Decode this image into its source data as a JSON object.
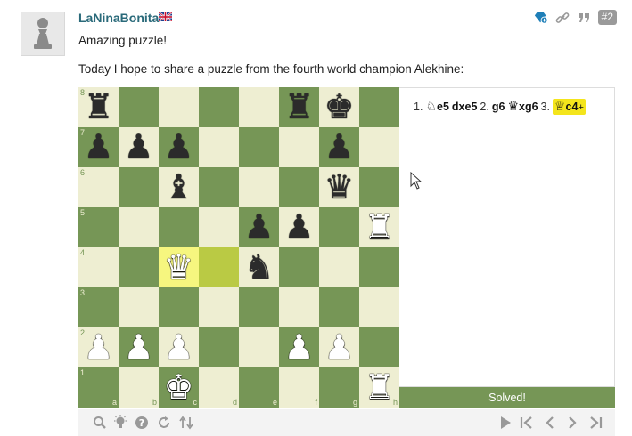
{
  "post": {
    "username": "LaNinaBonita",
    "flag_icon": "uk-flag-icon",
    "post_number": "#2",
    "greeting": "Amazing puzzle!",
    "intro": "Today I hope to share a puzzle from the fourth world champion Alekhine:"
  },
  "board": {
    "ranks": [
      "8",
      "7",
      "6",
      "5",
      "4",
      "3",
      "2",
      "1"
    ],
    "files": [
      "a",
      "b",
      "c",
      "d",
      "e",
      "f",
      "g",
      "h"
    ],
    "position": {
      "a8": "bR",
      "f8": "bR",
      "g8": "bK",
      "a7": "bP",
      "b7": "bP",
      "c7": "bP",
      "g7": "bP",
      "c6": "bB",
      "g6": "bQ",
      "e5": "bP",
      "f5": "bP",
      "h5": "wR",
      "c4": "wQ",
      "e4": "bN",
      "a2": "wP",
      "b2": "wP",
      "c2": "wP",
      "f2": "wP",
      "g2": "wP",
      "c1": "wK",
      "h1": "wR"
    },
    "highlights": [
      "c4",
      "d4"
    ],
    "colors": {
      "light": "#eeeed2",
      "dark": "#769656",
      "highlight": "#f6f67f"
    }
  },
  "moves": {
    "m1_num": "1.",
    "m1_white": "e5",
    "m1_white_piece": "♘",
    "m1_black": "dxe5",
    "m2_num": "2.",
    "m2_white": "g6",
    "m2_black": "xg6",
    "m2_black_piece": "♛",
    "m3_num": "3.",
    "m3_white": "c4",
    "m3_white_piece": "♕",
    "m3_check": "+"
  },
  "status": {
    "solved": "Solved!"
  },
  "controls": [
    "zoom-icon",
    "hint-icon",
    "help-icon",
    "reset-icon",
    "flip-icon",
    "play-icon",
    "first-move-icon",
    "prev-move-icon",
    "next-move-icon",
    "last-move-icon"
  ]
}
